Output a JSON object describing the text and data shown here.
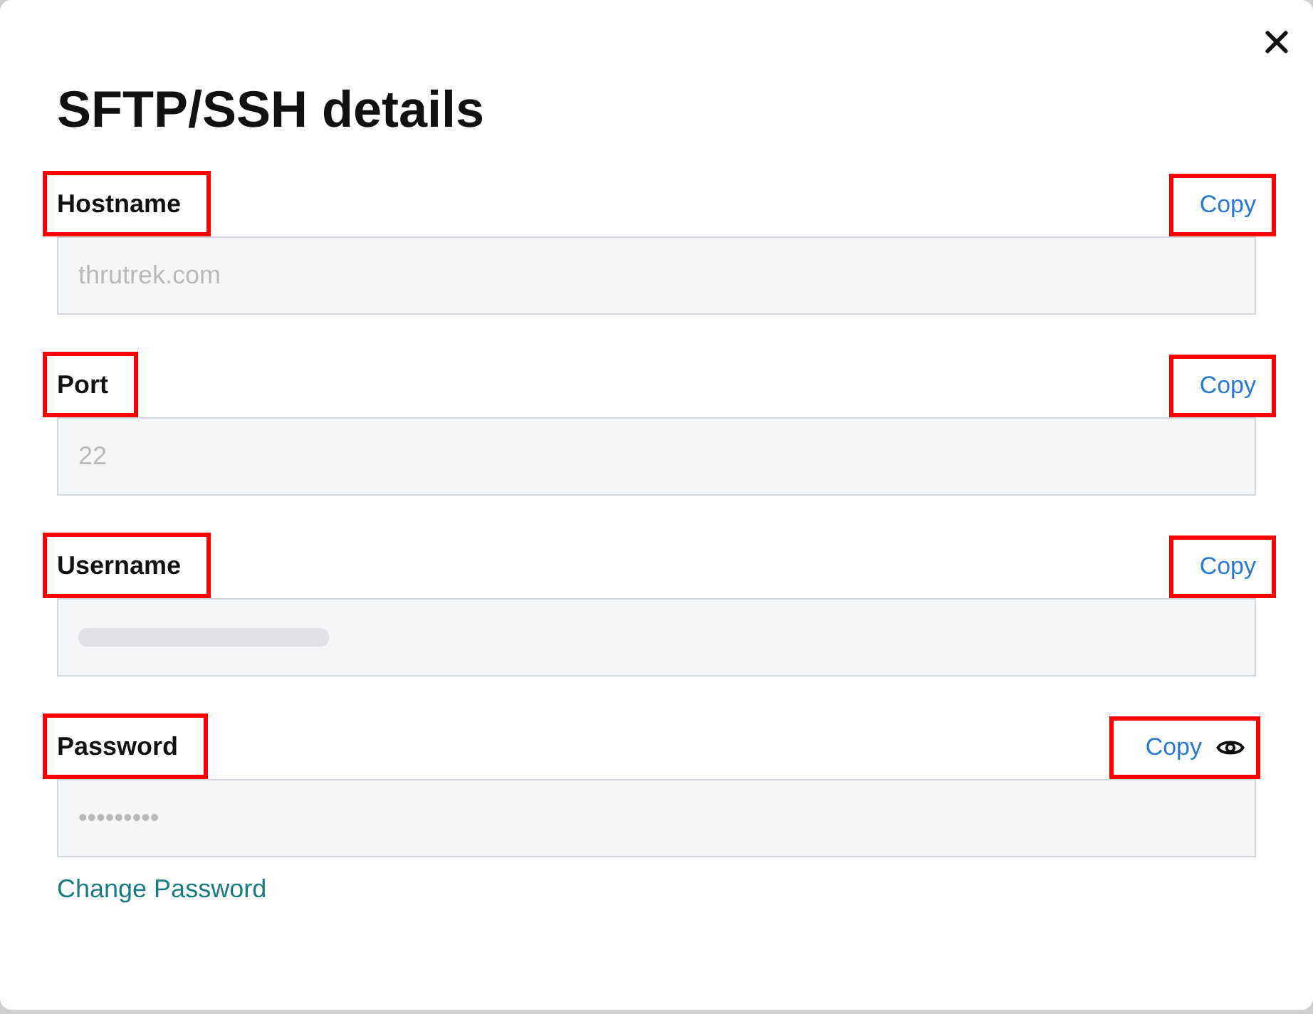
{
  "dialog": {
    "title": "SFTP/SSH details"
  },
  "fields": [
    {
      "label": "Hostname",
      "value": "thrutrek.com",
      "copy": "Copy",
      "highlighted": true,
      "blurred": false,
      "reveal_icon": false
    },
    {
      "label": "Port",
      "value": "22",
      "copy": "Copy",
      "highlighted": true,
      "blurred": false,
      "reveal_icon": false
    },
    {
      "label": "Username",
      "copy": "Copy",
      "highlighted": true,
      "blurred": true,
      "reveal_icon": false
    },
    {
      "label": "Password",
      "value": "•••••••••",
      "copy": "Copy",
      "highlighted": true,
      "blurred": false,
      "reveal_icon": true
    }
  ],
  "change_password_link": "Change Password"
}
